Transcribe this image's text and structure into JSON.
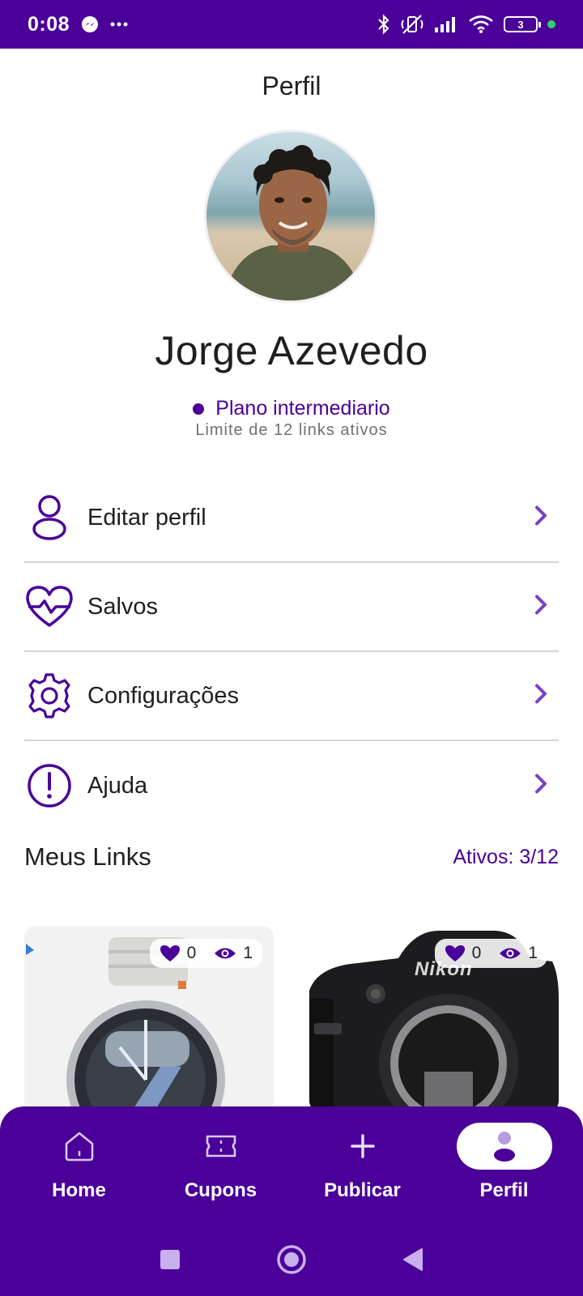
{
  "status_bar": {
    "time": "0:08",
    "battery": "3"
  },
  "header": {
    "title": "Perfil"
  },
  "profile": {
    "name": "Jorge Azevedo",
    "plan": "Plano intermediario",
    "plan_limit": "Limite de 12 links ativos"
  },
  "menu": {
    "items": [
      {
        "label": "Editar perfil",
        "icon": "user-icon"
      },
      {
        "label": "Salvos",
        "icon": "heart-pulse-icon"
      },
      {
        "label": "Configurações",
        "icon": "gear-icon"
      },
      {
        "label": "Ajuda",
        "icon": "alert-circle-icon"
      }
    ]
  },
  "links": {
    "title": "Meus Links",
    "count": "Ativos: 3/12",
    "cards": [
      {
        "likes": "0",
        "views": "1",
        "product": "smartwatch"
      },
      {
        "likes": "0",
        "views": "1",
        "product": "camera",
        "brand_text": "Nikon"
      }
    ]
  },
  "bottom_nav": {
    "items": [
      {
        "label": "Home",
        "icon": "home-icon"
      },
      {
        "label": "Cupons",
        "icon": "ticket-icon"
      },
      {
        "label": "Publicar",
        "icon": "plus-icon"
      },
      {
        "label": "Perfil",
        "icon": "profile-icon",
        "active": true
      }
    ]
  },
  "colors": {
    "primary": "#4a0099",
    "accent": "#7b3fc4",
    "divider": "#d4d4d4"
  }
}
